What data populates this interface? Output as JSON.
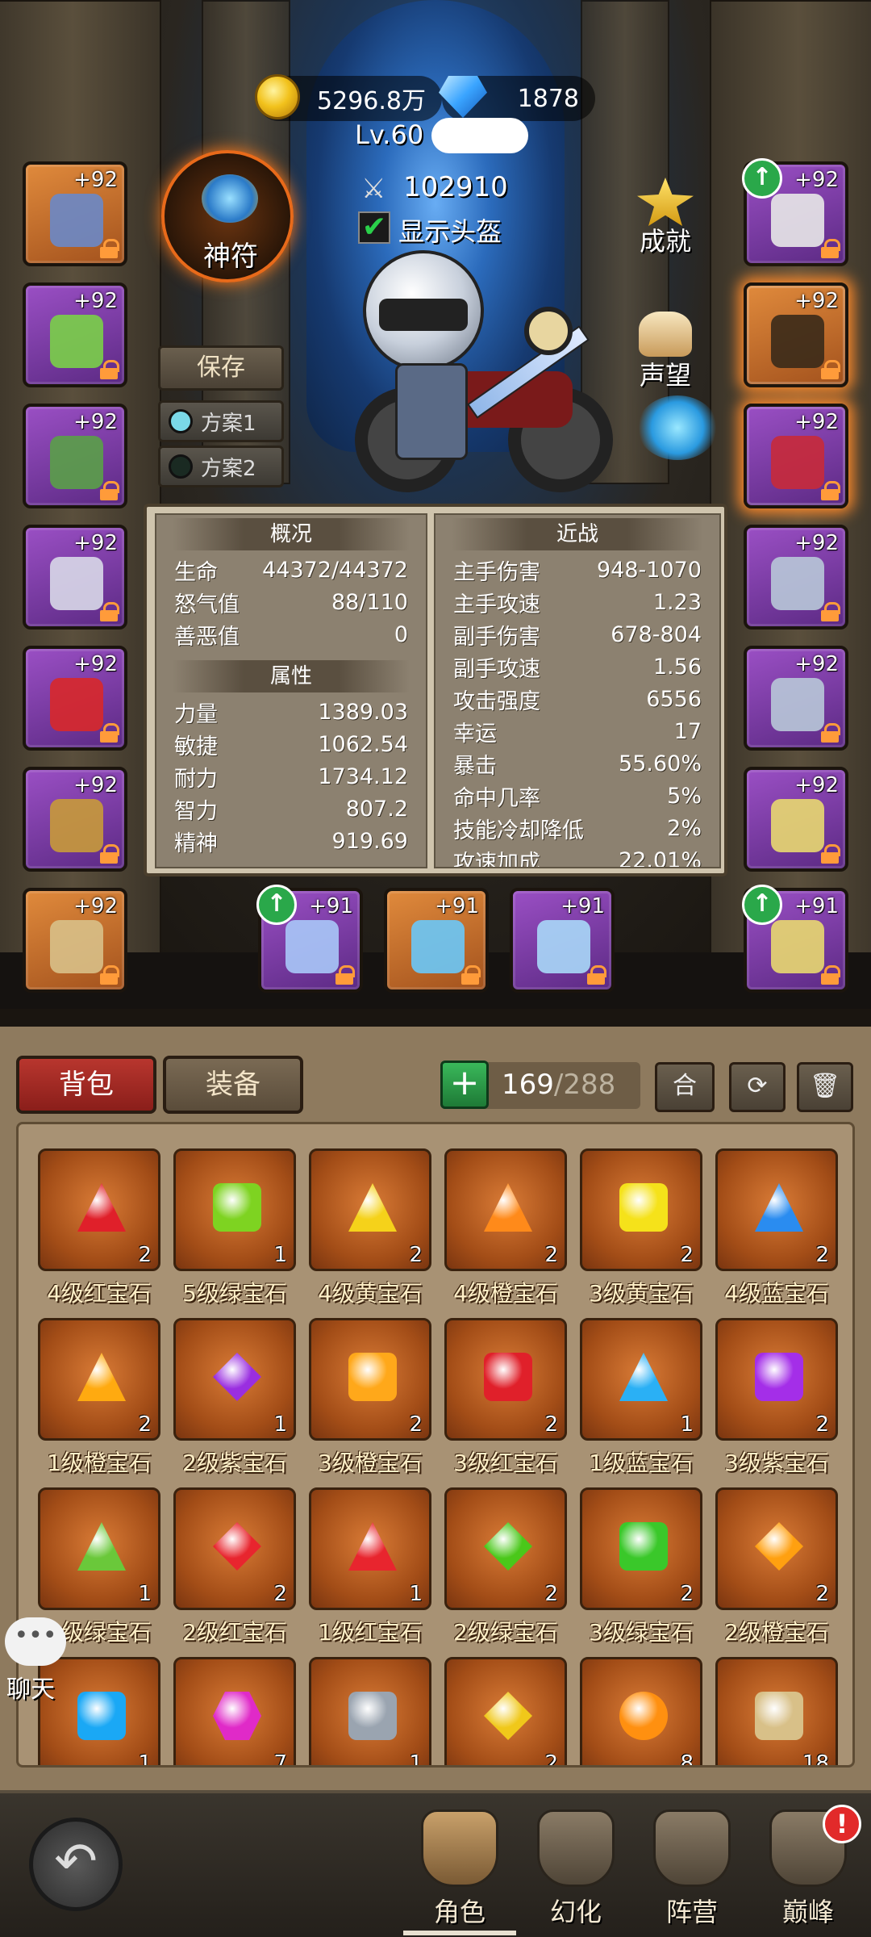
{
  "header": {
    "gold": "5296.8万",
    "diamonds": "1878",
    "level": "Lv.60",
    "combat_power": "102910",
    "show_helmet_label": "显示头盔",
    "show_helmet_checked": true
  },
  "scene_buttons": {
    "talisman": "神符",
    "achievement": "成就",
    "reputation": "声望",
    "save": "保存",
    "plan1": "方案1",
    "plan2": "方案2"
  },
  "equipment": {
    "left": [
      {
        "level": "+92",
        "rarity": "orange",
        "icon": "necklace-icon"
      },
      {
        "level": "+92",
        "rarity": "purple",
        "icon": "bead-bracelet-icon"
      },
      {
        "level": "+92",
        "rarity": "purple",
        "icon": "helmet-icon"
      },
      {
        "level": "+92",
        "rarity": "purple",
        "icon": "armor-icon"
      },
      {
        "level": "+92",
        "rarity": "purple",
        "icon": "bracer-icon"
      },
      {
        "level": "+92",
        "rarity": "purple",
        "icon": "shoulder-icon"
      },
      {
        "level": "+92",
        "rarity": "orange",
        "icon": "glove-icon"
      }
    ],
    "right": [
      {
        "level": "+92",
        "rarity": "purple",
        "icon": "skull-helm-icon",
        "upgrade": true
      },
      {
        "level": "+92",
        "rarity": "orange",
        "icon": "pants-icon",
        "glow": true
      },
      {
        "level": "+92",
        "rarity": "purple",
        "icon": "boots-icon",
        "glow": true
      },
      {
        "level": "+92",
        "rarity": "purple",
        "icon": "ring-icon"
      },
      {
        "level": "+92",
        "rarity": "purple",
        "icon": "ring-icon"
      },
      {
        "level": "+92",
        "rarity": "purple",
        "icon": "amulet-icon"
      },
      {
        "level": "+91",
        "rarity": "purple",
        "icon": "amulet-icon",
        "upgrade": true
      }
    ],
    "weapons": [
      {
        "level": "+91",
        "rarity": "purple",
        "icon": "sword-icon",
        "upgrade": true
      },
      {
        "level": "+91",
        "rarity": "orange",
        "icon": "blade-icon"
      },
      {
        "level": "+91",
        "rarity": "purple",
        "icon": "dagger-icon"
      }
    ]
  },
  "stats": {
    "overview_title": "概况",
    "overview": [
      {
        "label": "生命",
        "value": "44372/44372"
      },
      {
        "label": "怒气值",
        "value": "88/110"
      },
      {
        "label": "善恶值",
        "value": "0"
      }
    ],
    "attr_title": "属性",
    "attributes": [
      {
        "label": "力量",
        "value": "1389.03"
      },
      {
        "label": "敏捷",
        "value": "1062.54"
      },
      {
        "label": "耐力",
        "value": "1734.12"
      },
      {
        "label": "智力",
        "value": "807.2"
      },
      {
        "label": "精神",
        "value": "919.69"
      }
    ],
    "melee_title": "近战",
    "melee": [
      {
        "label": "主手伤害",
        "value": "948-1070"
      },
      {
        "label": "主手攻速",
        "value": "1.23"
      },
      {
        "label": "副手伤害",
        "value": "678-804"
      },
      {
        "label": "副手攻速",
        "value": "1.56"
      },
      {
        "label": "攻击强度",
        "value": "6556"
      },
      {
        "label": "幸运",
        "value": "17"
      },
      {
        "label": "暴击",
        "value": "55.60%"
      },
      {
        "label": "命中几率",
        "value": "5%"
      },
      {
        "label": "技能冷却降低",
        "value": "2%"
      },
      {
        "label": "攻速加成",
        "value": "22.01%"
      }
    ]
  },
  "inventory": {
    "tab_bag": "背包",
    "tab_equip": "装备",
    "add": "+",
    "count_used": "169",
    "count_total": "/288",
    "merge": "合",
    "items": [
      {
        "name": "4级红宝石",
        "count": "2",
        "color": "#e0202a",
        "shape": "tri"
      },
      {
        "name": "5级绿宝石",
        "count": "1",
        "color": "#7ed321",
        "shape": "sq"
      },
      {
        "name": "4级黄宝石",
        "count": "2",
        "color": "#f5d21a",
        "shape": "tri"
      },
      {
        "name": "4级橙宝石",
        "count": "2",
        "color": "#ff8a1a",
        "shape": "tri"
      },
      {
        "name": "3级黄宝石",
        "count": "2",
        "color": "#f5e21a",
        "shape": "sq"
      },
      {
        "name": "4级蓝宝石",
        "count": "2",
        "color": "#2a8cf0",
        "shape": "tri"
      },
      {
        "name": "1级橙宝石",
        "count": "2",
        "color": "#ffaa10",
        "shape": "tri"
      },
      {
        "name": "2级紫宝石",
        "count": "1",
        "color": "#9a2ee0",
        "shape": "dia"
      },
      {
        "name": "3级橙宝石",
        "count": "2",
        "color": "#ffa81a",
        "shape": "sq"
      },
      {
        "name": "3级红宝石",
        "count": "2",
        "color": "#e0202a",
        "shape": "sq"
      },
      {
        "name": "1级蓝宝石",
        "count": "1",
        "color": "#2ab0f5",
        "shape": "tri"
      },
      {
        "name": "3级紫宝石",
        "count": "2",
        "color": "#a42ee8",
        "shape": "sq"
      },
      {
        "name": "1级绿宝石",
        "count": "1",
        "color": "#6ac83a",
        "shape": "tri"
      },
      {
        "name": "2级红宝石",
        "count": "2",
        "color": "#e8252e",
        "shape": "dia"
      },
      {
        "name": "1级红宝石",
        "count": "1",
        "color": "#e8252e",
        "shape": "tri"
      },
      {
        "name": "2级绿宝石",
        "count": "2",
        "color": "#4ac81a",
        "shape": "dia"
      },
      {
        "name": "3级绿宝石",
        "count": "2",
        "color": "#3ac82a",
        "shape": "sq"
      },
      {
        "name": "2级橙宝石",
        "count": "2",
        "color": "#ffa010",
        "shape": "dia"
      },
      {
        "name": "",
        "count": "1",
        "color": "#1aa8f5",
        "shape": "sq"
      },
      {
        "name": "",
        "count": "7",
        "color": "#e02ac8",
        "shape": "hex"
      },
      {
        "name": "",
        "count": "1",
        "color": "#9aa4b0",
        "shape": "sq"
      },
      {
        "name": "",
        "count": "2",
        "color": "#f0c81a",
        "shape": "dia"
      },
      {
        "name": "",
        "count": "8",
        "color": "#ff9010",
        "shape": "round"
      },
      {
        "name": "",
        "count": "18",
        "color": "#d8c088",
        "shape": "sq"
      }
    ]
  },
  "chat": {
    "label": "聊天"
  },
  "nav": {
    "character": "角色",
    "illusion": "幻化",
    "camp": "阵营",
    "peak": "巅峰",
    "peak_badge": "!"
  }
}
